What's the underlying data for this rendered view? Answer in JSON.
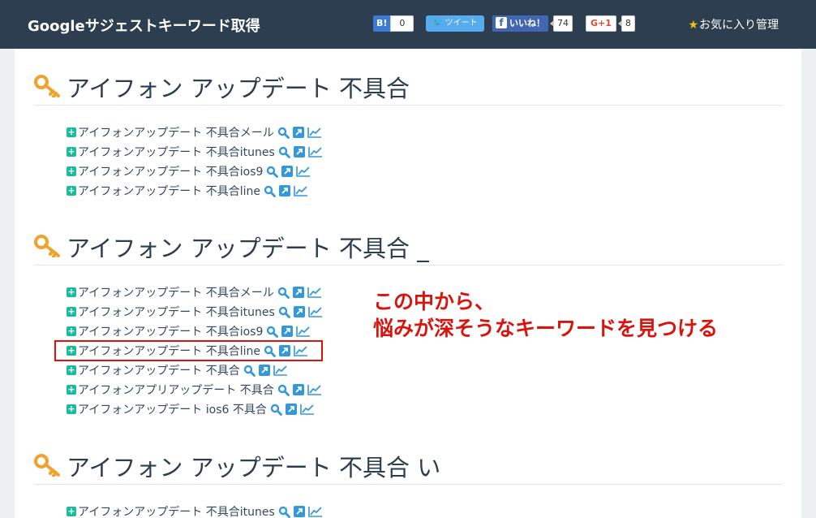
{
  "header": {
    "brand": "Googleサジェストキーワード取得",
    "hatena": {
      "label": "B!",
      "count": "0"
    },
    "tweet_label": "ツイート",
    "like": {
      "label": "いいね！",
      "count": "74"
    },
    "gplus": {
      "label": "G+1",
      "count": "8"
    },
    "favorites_label": "お気に入り管理"
  },
  "sections": [
    {
      "title": "アイフォン アップデート 不具合",
      "items": [
        "アイフォンアップデート 不具合メール",
        "アイフォンアップデート 不具合itunes",
        "アイフォンアップデート 不具合ios9",
        "アイフォンアップデート 不具合line"
      ]
    },
    {
      "title": "アイフォン アップデート 不具合 _",
      "items": [
        "アイフォンアップデート 不具合メール",
        "アイフォンアップデート 不具合itunes",
        "アイフォンアップデート 不具合ios9",
        "アイフォンアップデート 不具合line",
        "アイフォンアップデート 不具合",
        "アイフォンアプリアップデート 不具合",
        "アイフォンアップデート ios6 不具合"
      ]
    },
    {
      "title": "アイフォン アップデート 不具合 い",
      "items": [
        "アイフォンアップデート 不具合itunes"
      ]
    }
  ],
  "annotation": {
    "line1": "この中から、",
    "line2": "悩みが深そうなキーワードを見つける"
  },
  "colors": {
    "navbar": "#2c3e50",
    "accent_green": "#1abc9c",
    "icon_blue": "#3498db",
    "annotation_red": "#d9140e"
  }
}
